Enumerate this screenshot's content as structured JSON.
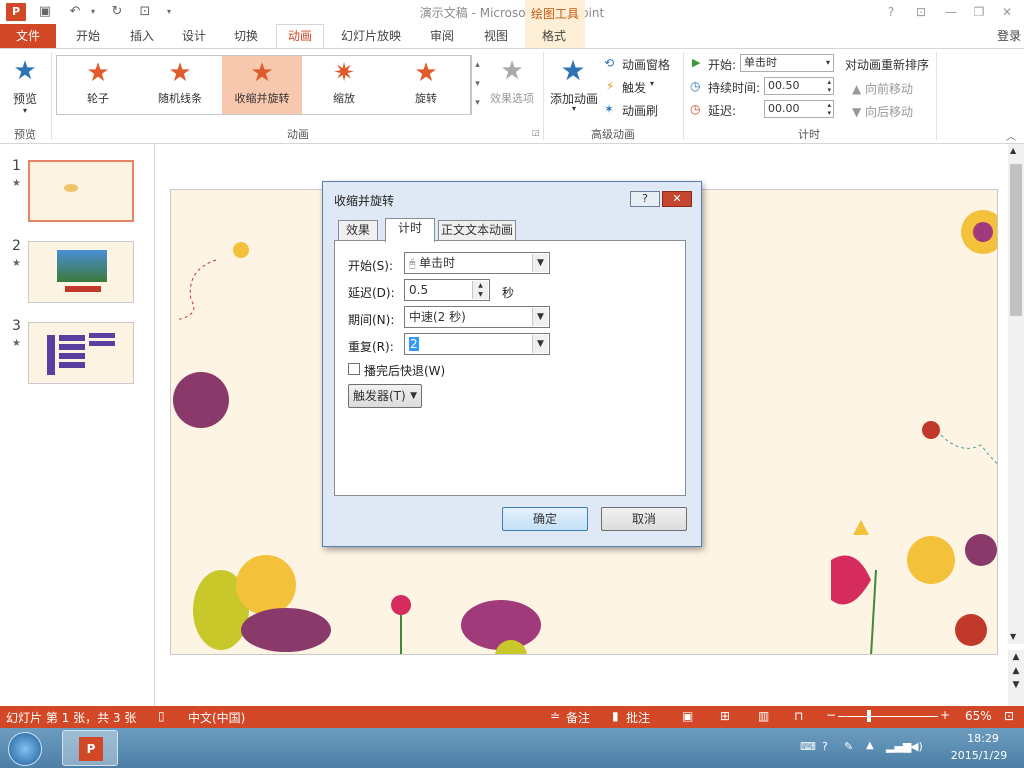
{
  "window": {
    "title": "演示文稿 - Microsoft PowerPoint",
    "context_tab": "绘图工具",
    "login": "登录"
  },
  "tabs": [
    "文件",
    "开始",
    "插入",
    "设计",
    "切换",
    "动画",
    "幻灯片放映",
    "审阅",
    "视图",
    "格式"
  ],
  "ribbon": {
    "preview": "预览",
    "preview_group": "预览",
    "gallery": [
      {
        "label": "轮子"
      },
      {
        "label": "随机线条"
      },
      {
        "label": "收缩并旋转"
      },
      {
        "label": "缩放"
      },
      {
        "label": "旋转"
      }
    ],
    "effect_options": "效果选项",
    "animation_group": "动画",
    "add_animation": "添加动画",
    "anim_pane": "动画窗格",
    "trigger": "触发",
    "anim_painter": "动画刷",
    "advanced_group": "高级动画",
    "start_label": "开始:",
    "start_value": "单击时",
    "duration_label": "持续时间:",
    "duration_value": "00.50",
    "delay_label": "延迟:",
    "delay_value": "00.00",
    "timing_group": "计时",
    "reorder": "对动画重新排序",
    "move_earlier": "向前移动",
    "move_later": "向后移动"
  },
  "thumbs": [
    {
      "num": "1"
    },
    {
      "num": "2"
    },
    {
      "num": "3"
    }
  ],
  "dialog": {
    "title": "收缩并旋转",
    "help": "?",
    "tabs": [
      "效果",
      "计时",
      "正文文本动画"
    ],
    "start_label": "开始(S):",
    "start_value": "单击时",
    "delay_label": "延迟(D):",
    "delay_value": "0.5",
    "delay_unit": "秒",
    "period_label": "期间(N):",
    "period_value": "中速(2 秒)",
    "repeat_label": "重复(R):",
    "repeat_value": "2",
    "rewind_label": "播完后快退(W)",
    "trigger_btn": "触发器(T)",
    "ok": "确定",
    "cancel": "取消"
  },
  "status": {
    "slide_info": "幻灯片 第 1 张，共 3 张",
    "language": "中文(中国)",
    "notes": "备注",
    "comments": "批注",
    "zoom": "65%"
  },
  "taskbar": {
    "time": "18:29",
    "date": "2015/1/29"
  }
}
